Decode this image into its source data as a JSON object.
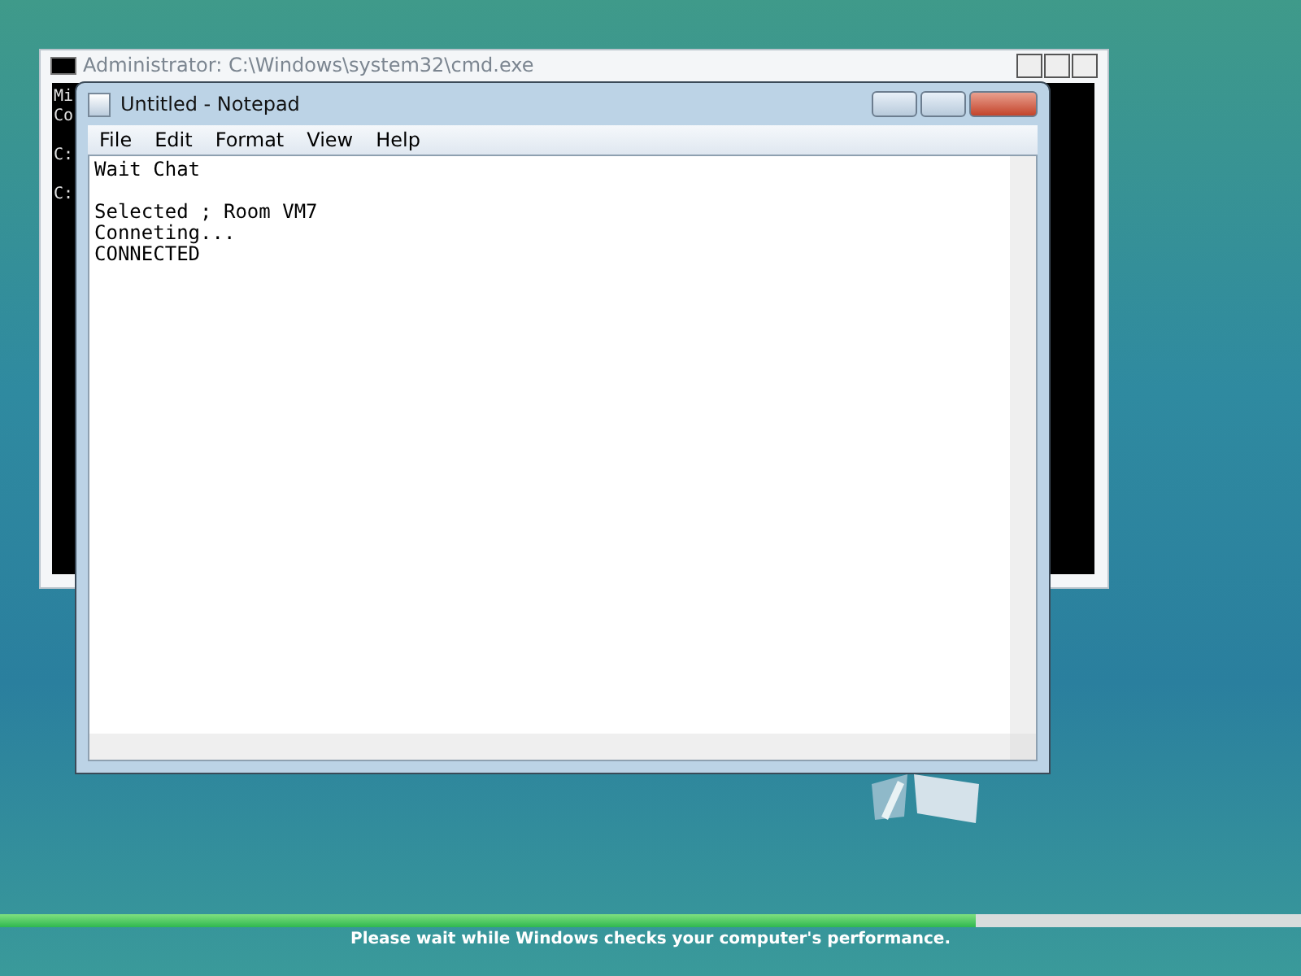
{
  "console_window": {
    "title": "Administrator: C:\\Windows\\system32\\cmd.exe",
    "blocks": [
      [
        "Mi",
        "Co"
      ],
      [
        "C:"
      ],
      [
        "C:"
      ]
    ]
  },
  "notepad": {
    "title": "Untitled - Notepad",
    "menu": [
      "File",
      "Edit",
      "Format",
      "View",
      "Help"
    ],
    "paragraphs": [
      [
        "Wait Chat"
      ],
      [
        "Selected ; Room VM7",
        "Conneting...",
        "CONNECTED"
      ]
    ]
  },
  "progress": {
    "level": 0.75,
    "message": "Please wait while Windows checks your computer's performance."
  }
}
